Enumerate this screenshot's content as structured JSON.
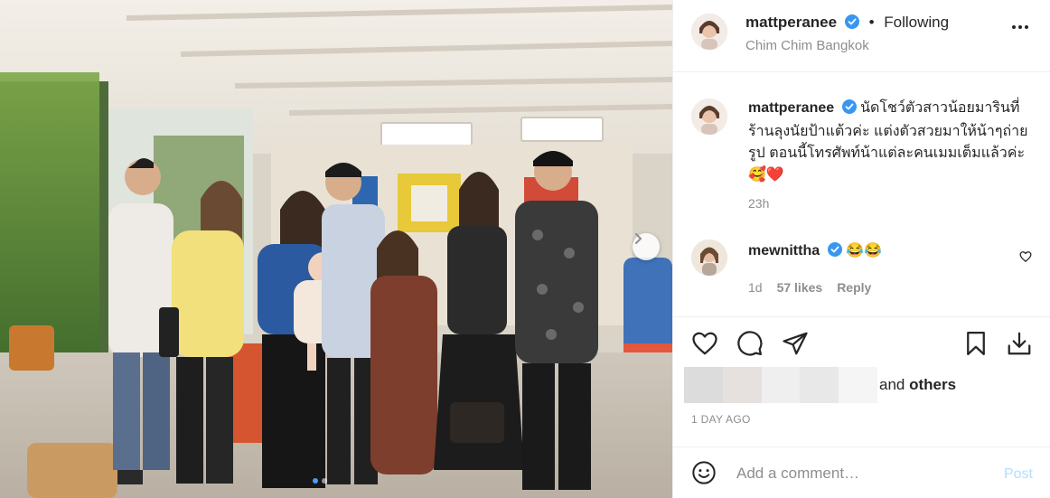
{
  "post": {
    "header": {
      "username": "mattperanee",
      "separator": "•",
      "following_label": "Following",
      "location": "Chim Chim Bangkok"
    },
    "caption": {
      "username": "mattperanee",
      "text_line1": "นัดโชว์ตัวสาวน้อยมารินที่",
      "text_line2": "ร้านลุงนัยป้าแต้วค่ะ แต่งตัวสวยมาให้น้าๆถ่าย",
      "text_line3": "รูป ตอนนี้โทรศัพท์น้าแต่ละคนเมมเต็มแล้วค่ะ",
      "emojis": "🥰❤️",
      "time": "23h"
    },
    "comment": {
      "username": "mewnittha",
      "text": "😂😂",
      "time": "1d",
      "likes": "57 likes",
      "reply_label": "Reply"
    },
    "likes": {
      "suffix_plain": "and",
      "suffix_bold": "others"
    },
    "timestamp": "1 DAY AGO",
    "comment_box": {
      "placeholder": "Add a comment…",
      "post_label": "Post"
    },
    "carousel": {
      "count": 2,
      "active": 0
    },
    "colors": {
      "verified": "#3897f0",
      "post_disabled": "#b2dffc",
      "muted": "#8e8e8e",
      "active_dot": "#4a9df8"
    }
  }
}
